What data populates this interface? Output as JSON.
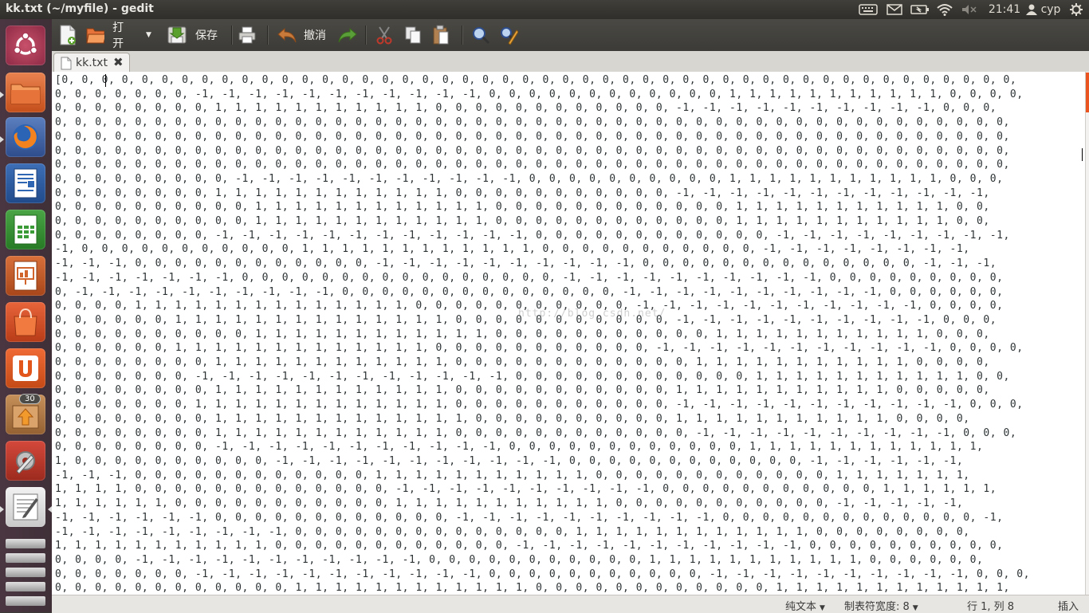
{
  "window": {
    "title": "kk.txt (~/myfile) - gedit"
  },
  "panel": {
    "clock": "21:41",
    "user": "cyp",
    "icons": [
      "keyboard-icon",
      "mail-icon",
      "battery-icon",
      "wifi-icon",
      "volume-muted-icon",
      "user-icon",
      "settings-gear-icon"
    ]
  },
  "launcher": {
    "items": [
      {
        "name": "ubuntu-dash",
        "icon": "ubuntu-logo-icon"
      },
      {
        "name": "files",
        "icon": "folder-icon"
      },
      {
        "name": "firefox",
        "icon": "firefox-icon"
      },
      {
        "name": "libreoffice-writer",
        "icon": "writer-icon"
      },
      {
        "name": "libreoffice-calc",
        "icon": "calc-icon"
      },
      {
        "name": "libreoffice-impress",
        "icon": "impress-icon"
      },
      {
        "name": "ubuntu-software",
        "icon": "shopping-bag-icon"
      },
      {
        "name": "ubuntu-one",
        "icon": "ubuntu-one-icon"
      },
      {
        "name": "software-updater",
        "icon": "update-icon",
        "badge": "30"
      },
      {
        "name": "system-settings",
        "icon": "settings-wrench-icon"
      },
      {
        "name": "gedit",
        "icon": "text-editor-icon"
      }
    ]
  },
  "toolbar": {
    "open_label": "打开",
    "save_label": "保存",
    "undo_label": "撤消"
  },
  "tab": {
    "label": "kk.txt"
  },
  "editor": {
    "lines": [
      "[0, 0, 0, 0, 0, 0, 0, 0, 0, 0, 0, 0, 0, 0, 0, 0, 0, 0, 0, 0, 0, 0, 0, 0, 0, 0, 0, 0, 0, 0, 0, 0, 0, 0, 0, 0, 0, 0, 0, 0, 0, 0, 0, 0, 0, 0, 0, 0,",
      "0, 0, 0, 0, 0, 0, 0, -1, -1, -1, -1, -1, -1, -1, -1, -1, -1, -1, 0, 0, 0, 0, 0, 0, 0, 0, 0, 0, 0, 0, 1, 1, 1, 1, 1, 1, 1, 1, 1, 1, 1, 0, 0, 0, 0,",
      "0, 0, 0, 0, 0, 0, 0, 0, 1, 1, 1, 1, 1, 1, 1, 1, 1, 1, 1, 0, 0, 0, 0, 0, 0, 0, 0, 0, 0, 0, 0, -1, -1, -1, -1, -1, -1, -1, -1, -1, -1, 0, 0, 0,",
      "0, 0, 0, 0, 0, 0, 0, 0, 0, 0, 0, 0, 0, 0, 0, 0, 0, 0, 0, 0, 0, 0, 0, 0, 0, 0, 0, 0, 0, 0, 0, 0, 0, 0, 0, 0, 0, 0, 0, 0, 0, 0, 0, 0, 0, 0, 0, 0,",
      "0, 0, 0, 0, 0, 0, 0, 0, 0, 0, 0, 0, 0, 0, 0, 0, 0, 0, 0, 0, 0, 0, 0, 0, 0, 0, 0, 0, 0, 0, 0, 0, 0, 0, 0, 0, 0, 0, 0, 0, 0, 0, 0, 0, 0, 0, 0, 0,",
      "0, 0, 0, 0, 0, 0, 0, 0, 0, 0, 0, 0, 0, 0, 0, 0, 0, 0, 0, 0, 0, 0, 0, 0, 0, 0, 0, 0, 0, 0, 0, 0, 0, 0, 0, 0, 0, 0, 0, 0, 0, 0, 0, 0, 0, 0, 0, 0,",
      "0, 0, 0, 0, 0, 0, 0, 0, 0, 0, 0, 0, 0, 0, 0, 0, 0, 0, 0, 0, 0, 0, 0, 0, 0, 0, 0, 0, 0, 0, 0, 0, 0, 0, 0, 0, 0, 0, 0, 0, 0, 0, 0, 0, 0, 0, 0, 0,",
      "0, 0, 0, 0, 0, 0, 0, 0, 0, -1, -1, -1, -1, -1, -1, -1, -1, -1, -1, -1, 0, 0, 0, 0, 0, 0, 0, 0, 0, 0, 1, 1, 1, 1, 1, 1, 1, 1, 1, 1, 1, 0, 0, 0,",
      "0, 0, 0, 0, 0, 0, 0, 0, 1, 1, 1, 1, 1, 1, 1, 1, 1, 1, 1, 1, 0, 0, 0, 0, 0, 0, 0, 0, 0, 0, 0, -1, -1, -1, -1, -1, -1, -1, -1, -1, -1, -1, -1,",
      "0, 0, 0, 0, 0, 0, 0, 0, 0, 0, 1, 1, 1, 1, 1, 1, 1, 1, 1, 1, 1, 1, 0, 0, 0, 0, 0, 0, 0, 0, 0, 0, 0, 0, 1, 1, 1, 1, 1, 1, 1, 1, 1, 1, 1, 0, 0,",
      "0, 0, 0, 0, 0, 0, 0, 0, 0, 0, 1, 1, 1, 1, 1, 1, 1, 1, 1, 1, 1, 1, 0, 0, 0, 0, 0, 0, 0, 0, 0, 0, 0, 0, 1, 1, 1, 1, 1, 1, 1, 1, 1, 1, 1, 0, 0,",
      "0, 0, 0, 0, 0, 0, 0, 0, -1, -1, -1, -1, -1, -1, -1, -1, -1, -1, -1, -1, 0, 0, 0, 0, 0, 0, 0, 0, 0, 0, 0, 0, -1, -1, -1, -1, -1, -1, -1, -1, -1,",
      "-1, 0, 0, 0, 0, 0, 0, 0, 0, 0, 0, 0, 1, 1, 1, 1, 1, 1, 1, 1, 1, 1, 1, 1, 0, 0, 0, 0, 0, 0, 0, 0, 0, 0, 0, -1, -1, -1, -1, -1, -1, -1, -1,",
      "-1, -1, -1, 0, 0, 0, 0, 0, 0, 0, 0, 0, 0, 0, 0, -1, -1, -1, -1, -1, -1, -1, -1, -1, -1, 0, 0, 0, 0, 0, 0, 0, 0, 0, 0, 0, 0, 0, 0, -1, -1, -1,",
      "-1, -1, -1, -1, -1, -1, -1, 0, 0, 0, 0, 0, 0, 0, 0, 0, 0, 0, 0, 0, 0, 0, 0, -1, -1, -1, -1, -1, -1, -1, -1, -1, -1, 0, 0, 0, 0, 0, 0, 0, 0, 0,",
      "0, -1, -1, -1, -1, -1, -1, -1, -1, -1, -1, 0, 0, 0, 0, 0, 0, 0, 0, 0, 0, 0, 0, 0, 0, -1, -1, -1, -1, -1, -1, -1, -1, -1, -1, 0, 0, 0, 0, 0, 0,",
      "0, 0, 0, 0, 1, 1, 1, 1, 1, 1, 1, 1, 1, 1, 1, 1, 1, 1, 0, 0, 0, 0, 0, 0, 0, 0, 0, 0, 0, -1, -1, -1, -1, -1, -1, -1, -1, -1, -1, -1, 0, 0, 0, 0,",
      "0, 0, 0, 0, 0, 0, 1, 1, 1, 1, 1, 1, 1, 1, 1, 1, 1, 1, 1, 1, 0, 0, 0, 0, 0, 0, 0, 0, 0, 0, 0, -1, -1, -1, -1, -1, -1, -1, -1, -1, -1, 0, 0, 0,",
      "0, 0, 0, 0, 0, 0, 0, 0, 0, 0, 1, 1, 1, 1, 1, 1, 1, 1, 1, 1, 1, 1, 0, 0, 0, 0, 0, 0, 0, 0, 0, 0, 0, 1, 1, 1, 1, 1, 1, 1, 1, 1, 1, 1, 0, 0, 0,",
      "0, 0, 0, 0, 0, 0, 1, 1, 1, 1, 1, 1, 1, 1, 1, 1, 1, 1, 1, 0, 0, 0, 0, 0, 0, 0, 0, 0, 0, 0, -1, -1, -1, -1, -1, -1, -1, -1, -1, -1, -1, 0, 0, 0, 0,",
      "0, 0, 0, 0, 0, 0, 0, 0, 1, 1, 1, 1, 1, 1, 1, 1, 1, 1, 1, 1, 0, 0, 0, 0, 0, 0, 0, 0, 0, 0, 0, 0, 1, 1, 1, 1, 1, 1, 1, 1, 1, 1, 1, 0, 0, 0, 0,",
      "0, 0, 0, 0, 0, 0, 0, -1, -1, -1, -1, -1, -1, -1, -1, -1, -1, -1, -1, 0, 0, 0, 0, 0, 0, 0, 0, 0, 0, 0, 0, 1, 1, 1, 1, 1, 1, 1, 1, 1, 1, 1, 0, 0,",
      "0, 0, 0, 0, 0, 0, 0, 0, 1, 1, 1, 1, 1, 1, 1, 1, 1, 1, 1, 1, 0, 0, 0, 0, 0, 0, 0, 0, 0, 0, 0, 1, 1, 1, 1, 1, 1, 1, 1, 1, 1, 1, 0, 0, 0, 0, 0,",
      "0, 0, 0, 0, 0, 0, 0, 1, 1, 1, 1, 1, 1, 1, 1, 1, 1, 1, 1, 1, 0, 0, 0, 0, 0, 0, 0, 0, 0, 0, 0, -1, -1, -1, -1, -1, -1, -1, -1, -1, -1, -1, 0, 0, 0,",
      "0, 0, 0, 0, 0, 0, 0, 0, 1, 1, 1, 1, 1, 1, 1, 1, 1, 1, 1, 1, 1, 0, 0, 0, 0, 0, 0, 0, 0, 0, 0, 1, 1, 1, 1, 1, 1, 1, 1, 1, 1, 1, 0, 0, 0, 0,",
      "0, 0, 0, 0, 0, 0, 0, 0, 1, 1, 1, 1, 1, 1, 1, 1, 1, 1, 1, 1, 0, 0, 0, 0, 0, 0, 0, 0, 0, 0, 0, 0, -1, -1, -1, -1, -1, -1, -1, -1, -1, -1, 0, 0, 0,",
      "0, 0, 0, 0, 0, 0, 0, 0, -1, -1, -1, -1, -1, -1, -1, -1, -1, -1, -1, 0, 0, 0, 0, 0, 0, 0, 0, 0, 0, 0, 0, 1, 1, 1, 1, 1, 1, 1, 1, 1, 1, 1, 1,",
      "1, 0, 0, 0, 0, 0, 0, 0, 0, 0, 0, -1, -1, -1, -1, -1, -1, -1, -1, -1, -1, -1, 0, 0, 0, 0, 0, 0, 0, 0, 0, 0, 0, 0, -1, -1, -1, -1, -1, -1,",
      "-1, -1, -1, 0, 0, 0, 0, 0, 0, 0, 0, 0, 0, 0, 0, 1, 1, 1, 1, 1, 1, 1, 1, 1, 1, 1, 0, 0, 0, 0, 0, 0, 0, 0, 0, 0, 0, 0, 1, 1, 1, 1, 1, 1, 1,",
      "1, 1, 1, 1, 0, 0, 0, 0, 0, 0, 0, 0, 0, 0, 0, 0, 0, -1, -1, -1, -1, -1, -1, -1, -1, -1, -1, 0, 0, 0, 0, 0, 0, 0, 0, 0, 0, 0, 1, 1, 1, 1, 1, 1,",
      "1, 1, 1, 1, 1, 1, 0, 0, 0, 0, 0, 0, 0, 0, 0, 0, 0, 1, 1, 1, 1, 1, 1, 1, 1, 1, 1, 1, 0, 0, 0, 0, 0, 0, 0, 0, 0, 0, 0, -1, -1, -1, -1, -1,",
      "-1, -1, -1, -1, -1, -1, 0, 0, 0, 0, 0, 0, 0, 0, 0, 0, 0, 0, -1, -1, -1, -1, -1, -1, -1, -1, -1, -1, 0, 0, 0, 0, 0, 0, 0, 0, 0, 0, 0, 0, 0, -1,",
      "-1, -1, -1, -1, -1, -1, -1, -1, -1, 0, 0, 0, 0, 0, 0, 0, 0, 0, 0, 0, 0, 0, 0, 1, 1, 1, 1, 1, 1, 1, 1, 1, 1, 1, 1, 0, 0, 0, 0, 0, 0, 0, 0,",
      "1, 1, 1, 1, 1, 1, 1, 1, 1, 1, 1, 0, 0, 0, 0, 0, 0, 0, 0, 0, 0, 0, 0, -1, -1, -1, -1, -1, -1, -1, -1, -1, -1, -1, 0, 0, 0, 0, 0, 0, 0, 0, 0, 0,",
      "0, 0, 0, 0, -1, -1, -1, -1, -1, -1, -1, -1, -1, -1, -1, 0, 0, 0, 0, 0, 0, 0, 0, 0, 0, 0, 1, 1, 1, 1, 1, 1, 1, 1, 1, 1, 1, 0, 0, 0, 0, 0, 0,",
      "0, 0, 0, 0, 0, 0, 0, -1, -1, -1, -1, -1, -1, -1, -1, -1, -1, -1, 0, 0, 0, 0, 0, 0, 0, 0, 0, 0, 0, -1, -1, -1, -1, -1, -1, -1, -1, -1, -1, 0, 0, 0,",
      "0, 0, 0, 0, 0, 0, 0, 0, 0, 0, 0, 0, 1, 1, 1, 1, 1, 1, 1, 1, 1, 1, 1, 1, 0, 0, 0, 0, 0, 0, 0, 0, 0, 0, 0, 0, 1, 1, 1, 1, 1, 1, 1, 1, 1, 1, 1, 1,"
    ]
  },
  "status": {
    "lang": "纯文本",
    "tab_width": "制表符宽度: 8",
    "position": "行 1, 列 8",
    "mode": "插入"
  }
}
